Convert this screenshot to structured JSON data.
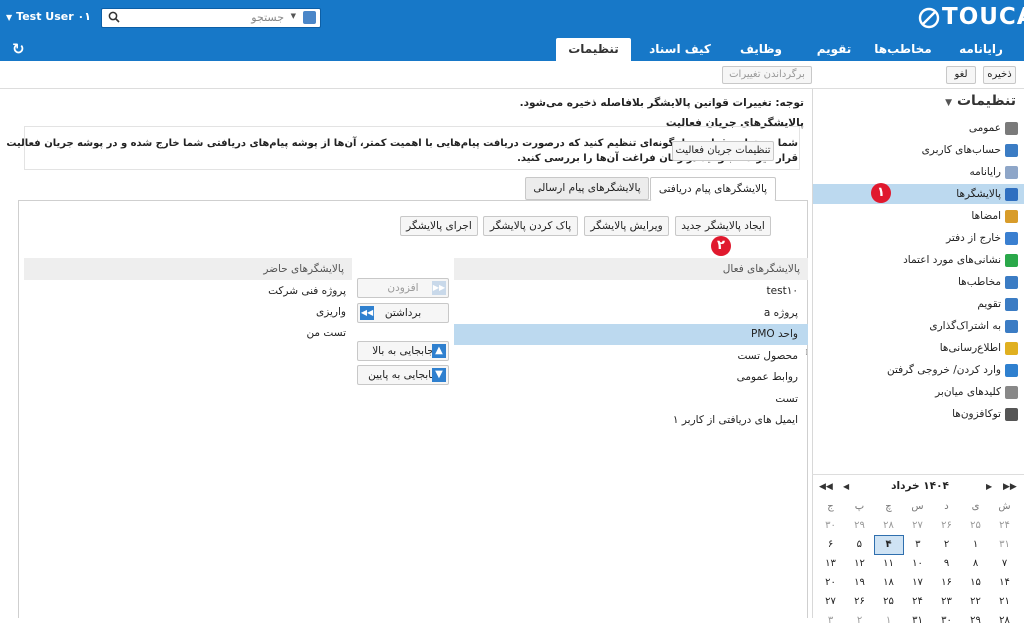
{
  "header": {
    "user_name": "Test User ۰۱",
    "search_placeholder": "جستجو",
    "logo_text": "TOUCA"
  },
  "tabs": [
    {
      "label": "رایانامه"
    },
    {
      "label": "مخاطب‌ها"
    },
    {
      "label": "تقویم"
    },
    {
      "label": "وظایف"
    },
    {
      "label": "کیف اسناد"
    },
    {
      "label": "تنظیمات"
    }
  ],
  "toolbar": {
    "save_label": "ذخیره",
    "cancel_label": "لغو",
    "revert_label": "برگرداندن تغییرات"
  },
  "sidebar": {
    "title": "تنظیمات",
    "items": [
      {
        "label": "عمومی",
        "icon": "gear-icon"
      },
      {
        "label": "حساب‌های کاربری",
        "icon": "account-icon"
      },
      {
        "label": "رایانامه",
        "icon": "mail-icon"
      },
      {
        "label": "پالایشگرها",
        "icon": "filter-icon"
      },
      {
        "label": "امضاها",
        "icon": "signature-icon"
      },
      {
        "label": "خارج از دفتر",
        "icon": "out-of-office-icon"
      },
      {
        "label": "نشانی‌های مورد اعتماد",
        "icon": "shield-icon"
      },
      {
        "label": "مخاطب‌ها",
        "icon": "contact-icon"
      },
      {
        "label": "تقویم",
        "icon": "calendar-icon"
      },
      {
        "label": "به اشتراک‌گذاری",
        "icon": "share-icon"
      },
      {
        "label": "اطلاع‌رسانی‌ها",
        "icon": "bell-icon"
      },
      {
        "label": "وارد کردن/ خروجی گرفتن",
        "icon": "import-export-icon"
      },
      {
        "label": "کلیدهای میان‌بر",
        "icon": "keyboard-icon"
      },
      {
        "label": "توکافزون‌ها",
        "icon": "addon-icon"
      }
    ],
    "selected_index": 3
  },
  "calendar": {
    "month_title": "۱۴۰۴ خرداد",
    "weekdays": [
      "ش",
      "ی",
      "د",
      "س",
      "چ",
      "پ",
      "ج"
    ],
    "weeks": [
      [
        "۲۴",
        "۲۵",
        "۲۶",
        "۲۷",
        "۲۸",
        "۲۹",
        "۳۰"
      ],
      [
        "۳۱",
        "۱",
        "۲",
        "۳",
        "۴",
        "۵",
        "۶"
      ],
      [
        "۷",
        "۸",
        "۹",
        "۱۰",
        "۱۱",
        "۱۲",
        "۱۳"
      ],
      [
        "۱۴",
        "۱۵",
        "۱۶",
        "۱۷",
        "۱۸",
        "۱۹",
        "۲۰"
      ],
      [
        "۲۱",
        "۲۲",
        "۲۳",
        "۲۴",
        "۲۵",
        "۲۶",
        "۲۷"
      ],
      [
        "۲۸",
        "۲۹",
        "۳۰",
        "۳۱",
        "۱",
        "۲",
        "۳"
      ]
    ],
    "today": "۴"
  },
  "main": {
    "note": "توجه: تغییرات قوانین پالایشگر بلافاصله ذخیره می‌شود.",
    "section_title": "پالایشگرهای جریان فعالیت",
    "section_desc_line1": "شما می‌توانید قوانین را بگونه‌ای تنظیم کنید که درصورت دریافت پیام‌هایی با اهمیت کمتر، آن‌ها از پوشه پیام‌های دریافتی شما خارج شده و در پوشه جریان فعالیت",
    "section_desc_line2": "قرار گیرند تا بتوانید در زمان فراغت آن‌ها را بررسی کنید.",
    "activity_settings_button": "تنظیمات جریان فعالیت",
    "subtabs": [
      {
        "label": "پالایشگرهای پیام دریافتی"
      },
      {
        "label": "پالایشگرهای پیام ارسالی"
      }
    ],
    "actions": {
      "new": "ایجاد پالایشگر جدید",
      "edit": "ویرایش پالایشگر",
      "delete": "پاک کردن پالایشگر",
      "run": "اجرای پالایشگر"
    },
    "active_filters_header": "پالایشگرهای فعال",
    "active_filters": [
      "test۱۰",
      "پروژه a",
      "واحد PMO",
      "محصول تست",
      "روابط عمومی",
      "تست",
      "ایمیل های دریافتی از کاربر ۱"
    ],
    "active_selected_index": 2,
    "existing_filters_header": "پالایشگرهای حاضر",
    "existing_filters": [
      "پروژه فنی شرکت",
      "واریزی",
      "تست من"
    ],
    "transfer": {
      "add": "افزودن",
      "remove": "برداشتن",
      "move_up": "جابجایی به بالا",
      "move_down": "جابجایی به پایین"
    }
  },
  "markers": [
    "۱",
    "۲"
  ],
  "colors": {
    "topbar": "#1778c8",
    "selected_row": "#bcd9ef",
    "selected_side": "#bcd9ef",
    "marker": "#e0192e"
  }
}
